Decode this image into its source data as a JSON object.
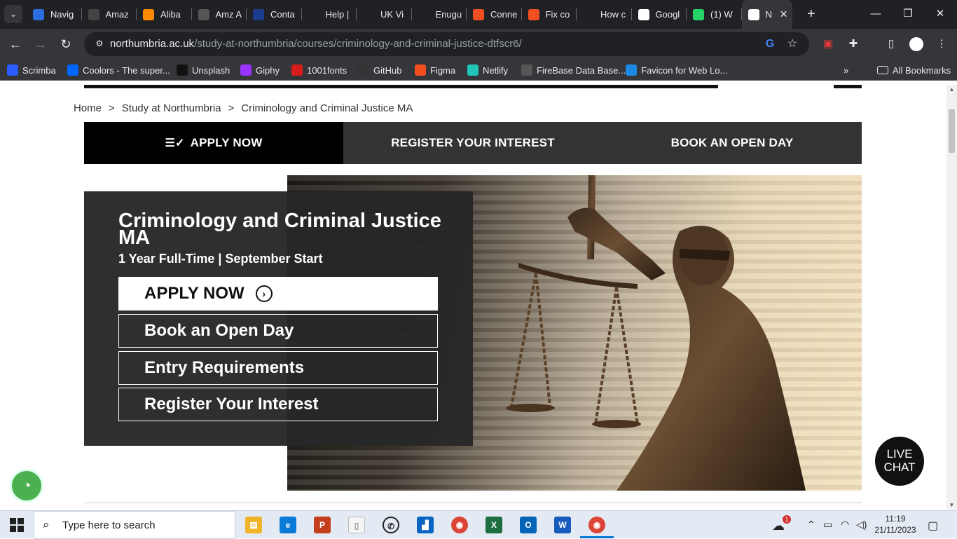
{
  "browser": {
    "tabs": [
      {
        "label": "Navig",
        "icon": "navigator-icon",
        "color": "#2b6de0"
      },
      {
        "label": "Amaz",
        "icon": "amazon-icon",
        "color": "#444444"
      },
      {
        "label": "Aliba",
        "icon": "alibaba-icon",
        "color": "#ff8a00"
      },
      {
        "label": "Amz A",
        "icon": "amz-icon",
        "color": "#555555"
      },
      {
        "label": "Conta",
        "icon": "tls-icon",
        "color": "#1b3c8c"
      },
      {
        "label": "Help |",
        "icon": "loading-icon",
        "color": "#202124"
      },
      {
        "label": "UK Vi",
        "icon": "loading-icon",
        "color": "#202124"
      },
      {
        "label": "Enugu",
        "icon": "loading-icon",
        "color": "#202124"
      },
      {
        "label": "Conne",
        "icon": "microsoft-icon",
        "color": "#f25022"
      },
      {
        "label": "Fix co",
        "icon": "microsoft-icon",
        "color": "#f25022"
      },
      {
        "label": "How c",
        "icon": "page-icon",
        "color": "#202124"
      },
      {
        "label": "Googl",
        "icon": "google-lens-icon",
        "color": "#ffffff"
      },
      {
        "label": "(1) W",
        "icon": "whatsapp-icon",
        "color": "#25d366"
      },
      {
        "label": "N",
        "icon": "northumbria-icon",
        "color": "#ffffff"
      }
    ],
    "url_host": "northumbria.ac.uk",
    "url_path": "/study-at-northumbria/courses/criminology-and-criminal-justice-dtfscr6/",
    "bookmarks": [
      {
        "label": "Scrimba",
        "color": "#2b5cff"
      },
      {
        "label": "Coolors - The super...",
        "color": "#0066ff"
      },
      {
        "label": "Unsplash",
        "color": "#111111"
      },
      {
        "label": "Giphy",
        "color": "#9933ff"
      },
      {
        "label": "1001fonts",
        "color": "#d81b1b"
      },
      {
        "label": "GitHub",
        "color": "#333333"
      },
      {
        "label": "Figma",
        "color": "#f24e1e"
      },
      {
        "label": "Netlify",
        "color": "#20c6b7"
      },
      {
        "label": "FireBase Data Base...",
        "color": "#555555"
      },
      {
        "label": "Favicon for Web Lo...",
        "color": "#1e88e5"
      }
    ],
    "all_bookmarks": "All Bookmarks",
    "overflow": "»"
  },
  "page": {
    "breadcrumb": [
      "Home",
      "Study at Northumbria",
      "Criminology and Criminal Justice MA"
    ],
    "breadcrumb_sep": ">",
    "actions": {
      "apply": "APPLY NOW",
      "register": "REGISTER YOUR INTEREST",
      "open_day": "BOOK AN OPEN DAY"
    },
    "course": {
      "title": "Criminology and Criminal Justice MA",
      "subtitle": "1 Year Full-Time | September Start"
    },
    "cta": {
      "apply": "APPLY NOW",
      "open_day": "Book an Open Day",
      "entry": "Entry Requirements",
      "register": "Register Your Interest"
    },
    "live_chat_line1": "LIVE",
    "live_chat_line2": "CHAT"
  },
  "taskbar": {
    "search_placeholder": "Type here to search",
    "time": "11:19",
    "date": "21/11/2023",
    "weather_badge": "1"
  }
}
